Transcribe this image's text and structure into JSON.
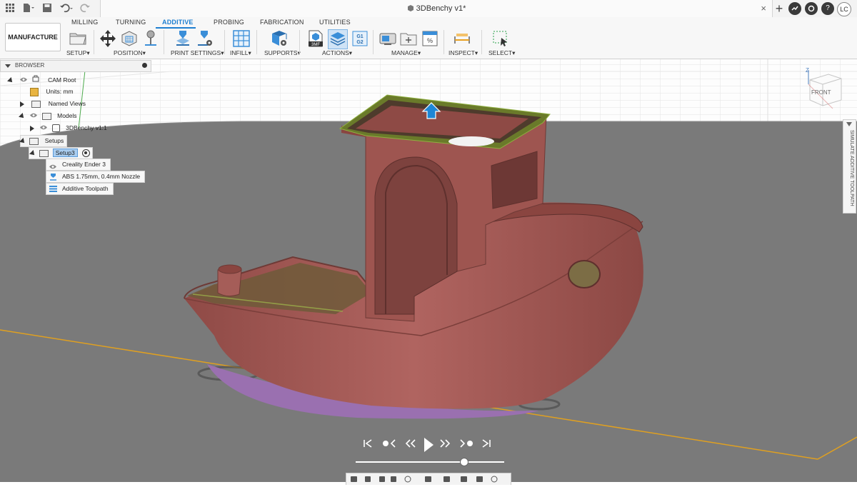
{
  "titlebar": {
    "doc_title": "3DBenchy v1*",
    "close_glyph": "×",
    "avatar": "LC",
    "icons": [
      "apps-grid-icon",
      "file-icon",
      "save-icon",
      "undo-icon",
      "redo-icon",
      "plus-icon",
      "job-status-icon",
      "notifications-icon",
      "help-icon"
    ]
  },
  "ribbon": {
    "tabs": [
      "MILLING",
      "TURNING",
      "ADDITIVE",
      "PROBING",
      "FABRICATION",
      "UTILITIES"
    ],
    "active_tab": "ADDITIVE",
    "workspace": "MANUFACTURE",
    "groups": [
      "SETUP",
      "POSITION",
      "PRINT SETTINGS",
      "INFILL",
      "SUPPORTS",
      "ACTIONS",
      "MANAGE",
      "INSPECT",
      "SELECT"
    ],
    "caret": "▾",
    "accent": "#1e7fd1"
  },
  "browser": {
    "title": "BROWSER",
    "items": [
      {
        "label": "CAM Root"
      },
      {
        "label": "Units: mm"
      },
      {
        "label": "Named Views"
      },
      {
        "label": "Models"
      },
      {
        "label": "3DBenchy v1:1"
      },
      {
        "label": "Setups"
      },
      {
        "label": "Setup3"
      },
      {
        "label": "Creality Ender 3"
      },
      {
        "label": "ABS 1.75mm, 0.4mm Nozzle"
      },
      {
        "label": "Additive Toolpath"
      }
    ]
  },
  "viewcube": {
    "face": "FRONT",
    "axis": "Z"
  },
  "side_panel": {
    "label": "SIMULATE ADDITIVE TOOLPATH"
  },
  "playback": {
    "glyphs": [
      "⏮",
      "●‹",
      "«",
      "▶",
      "»",
      "›●",
      "⏭"
    ],
    "progress_fraction": 0.73
  },
  "colors": {
    "model": "#a45a55",
    "infill": "#7a8a2a",
    "build_plate": "#7a7a7a",
    "grid": "#e3e3e3",
    "axis": "#e0a020"
  }
}
